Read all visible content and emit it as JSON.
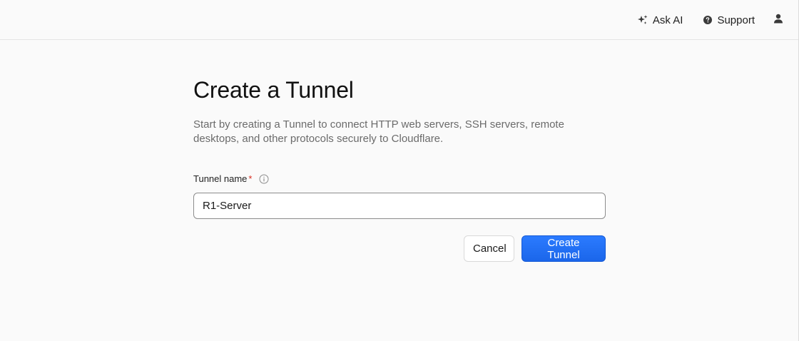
{
  "topbar": {
    "ask_ai_label": "Ask AI",
    "support_label": "Support",
    "icons": {
      "ask_ai": "sparkle-icon",
      "support": "help-circle-icon",
      "user": "user-icon"
    }
  },
  "form": {
    "title": "Create a Tunnel",
    "description": "Start by creating a Tunnel to connect HTTP web servers, SSH servers, remote desktops, and other protocols securely to Cloudflare.",
    "tunnel_name_label": "Tunnel name",
    "required_marker": "*",
    "tunnel_name_value": "R1-Server",
    "cancel_label": "Cancel",
    "submit_label": "Create Tunnel"
  },
  "colors": {
    "primary": "#1f6ff5",
    "required": "#d92d20",
    "background": "#fafafa"
  }
}
